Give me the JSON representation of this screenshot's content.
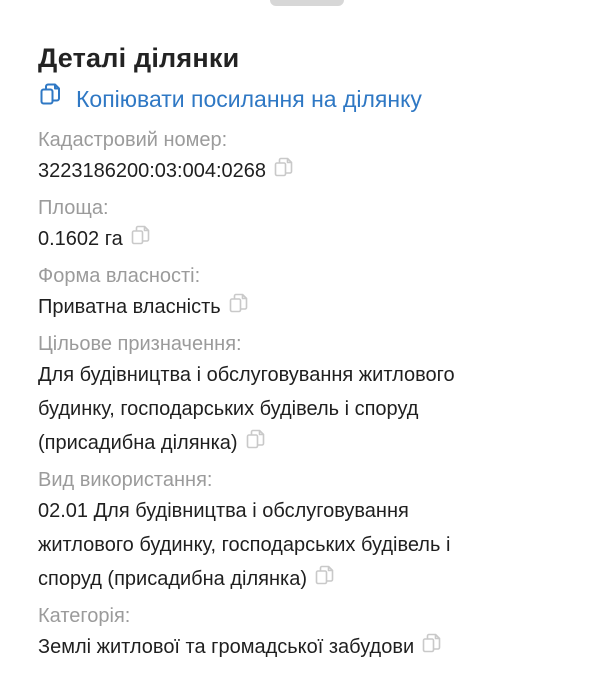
{
  "header": {
    "title": "Деталі ділянки",
    "copy_link_label": "Копіювати посилання на ділянку"
  },
  "fields": [
    {
      "label": "Кадастровий номер:",
      "value_lines": [
        "3223186200:03:004:0268"
      ]
    },
    {
      "label": "Площа:",
      "value_lines": [
        "0.1602 га"
      ]
    },
    {
      "label": "Форма власності:",
      "value_lines": [
        "Приватна власність"
      ]
    },
    {
      "label": "Цільове призначення:",
      "value_lines": [
        "Для будівництва і обслуговування житлового",
        "будинку, господарських будівель і споруд",
        "(присадибна ділянка)"
      ]
    },
    {
      "label": "Вид використання:",
      "value_lines": [
        "02.01 Для будівництва і обслуговування",
        "житлового будинку, господарських будівель і",
        "споруд (присадибна ділянка)"
      ]
    },
    {
      "label": "Категорія:",
      "value_lines": [
        "Землі житлової та громадської забудови"
      ]
    }
  ],
  "icons": {
    "copy": "copy-icon",
    "link_copy": "copy-link-icon"
  },
  "colors": {
    "link": "#2f78c4",
    "label": "#9b9b9b",
    "value": "#1f1f1f",
    "icon_muted": "#c9c9c9"
  }
}
